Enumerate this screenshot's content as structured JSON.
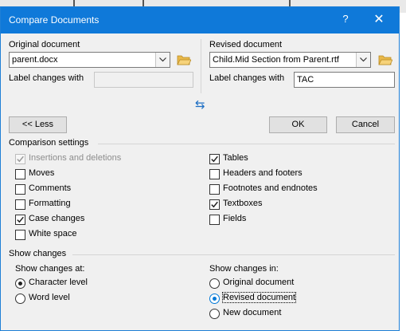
{
  "window": {
    "title": "Compare Documents",
    "help_label": "?",
    "close_label": "✕"
  },
  "original": {
    "label": "Original document",
    "value": "parent.docx",
    "label_changes_label": "Label changes with",
    "label_changes_value": ""
  },
  "revised": {
    "label": "Revised document",
    "value": "Child.Mid Section from Parent.rtf",
    "label_changes_label": "Label changes with",
    "label_changes_value": "TAC"
  },
  "swap_label": "⇆",
  "buttons": {
    "less": "<< Less",
    "ok": "OK",
    "cancel": "Cancel"
  },
  "comparison_settings": {
    "heading": "Comparison settings",
    "left": [
      {
        "label": "Insertions and deletions",
        "checked": true,
        "disabled": true
      },
      {
        "label": "Moves",
        "checked": false,
        "disabled": false
      },
      {
        "label": "Comments",
        "checked": false,
        "disabled": false
      },
      {
        "label": "Formatting",
        "checked": false,
        "disabled": false
      },
      {
        "label": "Case changes",
        "checked": true,
        "disabled": false
      },
      {
        "label": "White space",
        "checked": false,
        "disabled": false
      }
    ],
    "right": [
      {
        "label": "Tables",
        "checked": true,
        "disabled": false
      },
      {
        "label": "Headers and footers",
        "checked": false,
        "disabled": false
      },
      {
        "label": "Footnotes and endnotes",
        "checked": false,
        "disabled": false
      },
      {
        "label": "Textboxes",
        "checked": true,
        "disabled": false
      },
      {
        "label": "Fields",
        "checked": false,
        "disabled": false
      }
    ]
  },
  "show_changes": {
    "heading": "Show changes",
    "at_label": "Show changes at:",
    "at_options": [
      {
        "label": "Character level",
        "selected": true
      },
      {
        "label": "Word level",
        "selected": false
      }
    ],
    "in_label": "Show changes in:",
    "in_options": [
      {
        "label": "Original document",
        "selected": false
      },
      {
        "label": "Revised document",
        "selected": true
      },
      {
        "label": "New document",
        "selected": false
      }
    ]
  },
  "colors": {
    "titlebar": "#0f79d9",
    "dialog_bg": "#f0f0f0",
    "accent": "#0078d7"
  }
}
